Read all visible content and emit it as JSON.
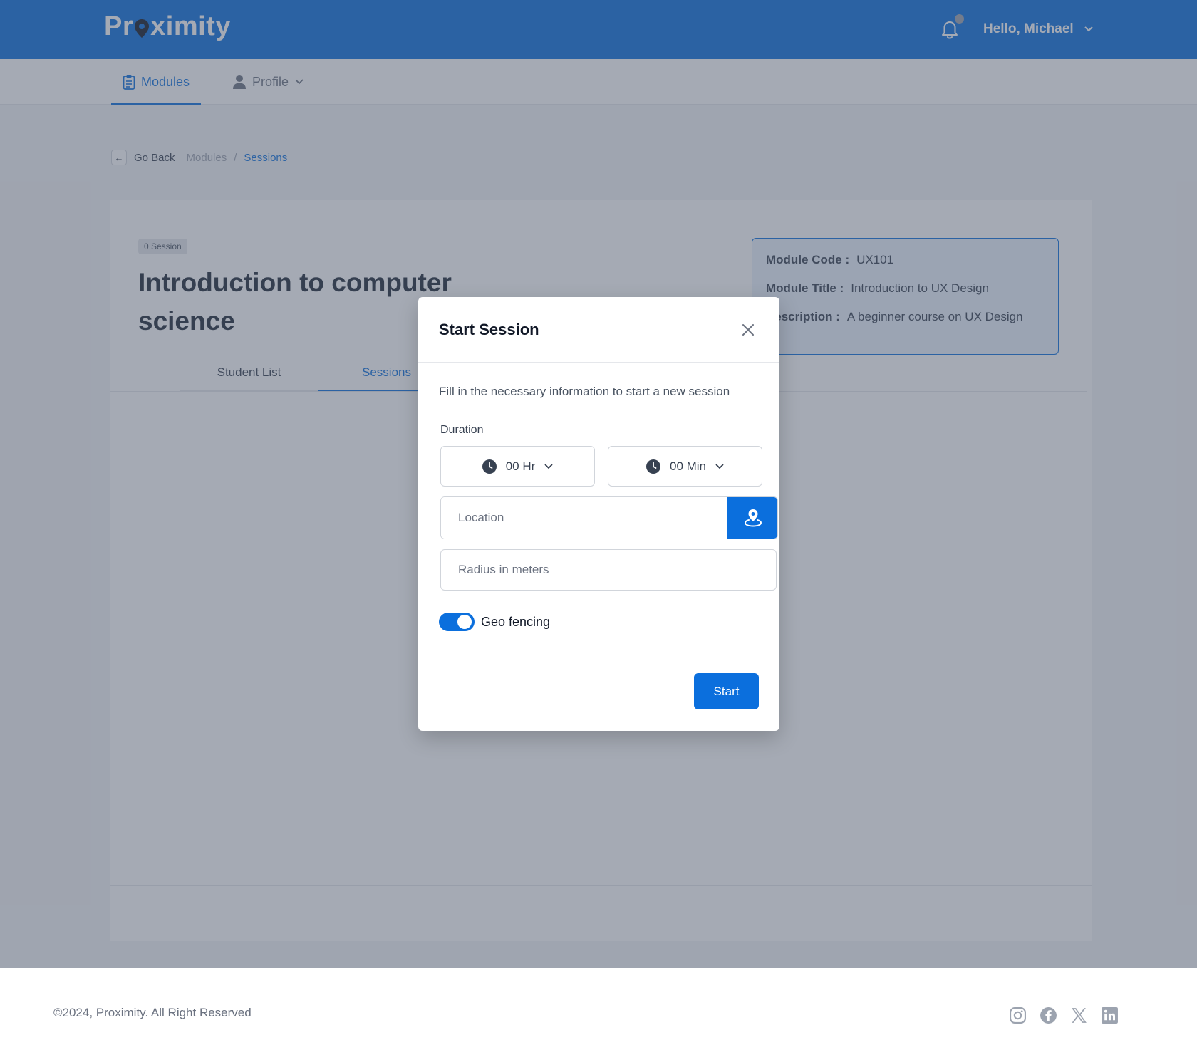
{
  "header": {
    "logo_text_a": "Pr",
    "logo_text_b": "ximity",
    "greeting": "Hello, Michael"
  },
  "nav": {
    "modules": "Modules",
    "profile": "Profile"
  },
  "breadcrumb": {
    "back": "Go Back",
    "modules": "Modules",
    "separator": "/",
    "current": "Sessions"
  },
  "course": {
    "badge": "0 Session",
    "title": "Introduction to computer science",
    "tabs": [
      {
        "label": "Student List"
      },
      {
        "label": "Sessions"
      }
    ]
  },
  "module_info": {
    "code_label": "Module Code :",
    "code_value": "UX101",
    "title_label": "Module Title :",
    "title_value": "Introduction to UX Design",
    "desc_label": "Description :",
    "desc_value": "A beginner course on UX Design"
  },
  "modal": {
    "title": "Start Session",
    "description": "Fill in the necessary information to start a new session",
    "duration_label": "Duration",
    "hours_value": "00 Hr",
    "minutes_value": "00 Min",
    "location_placeholder": "Location",
    "radius_placeholder": "Radius in meters",
    "geofencing_label": "Geo fencing",
    "geofencing_on": true,
    "start_label": "Start"
  },
  "footer": {
    "copyright": "©2024, Proximity. All Right Reserved"
  },
  "colors": {
    "primary": "#0b6fdd",
    "overlay": "rgba(75,85,105,0.5)"
  }
}
